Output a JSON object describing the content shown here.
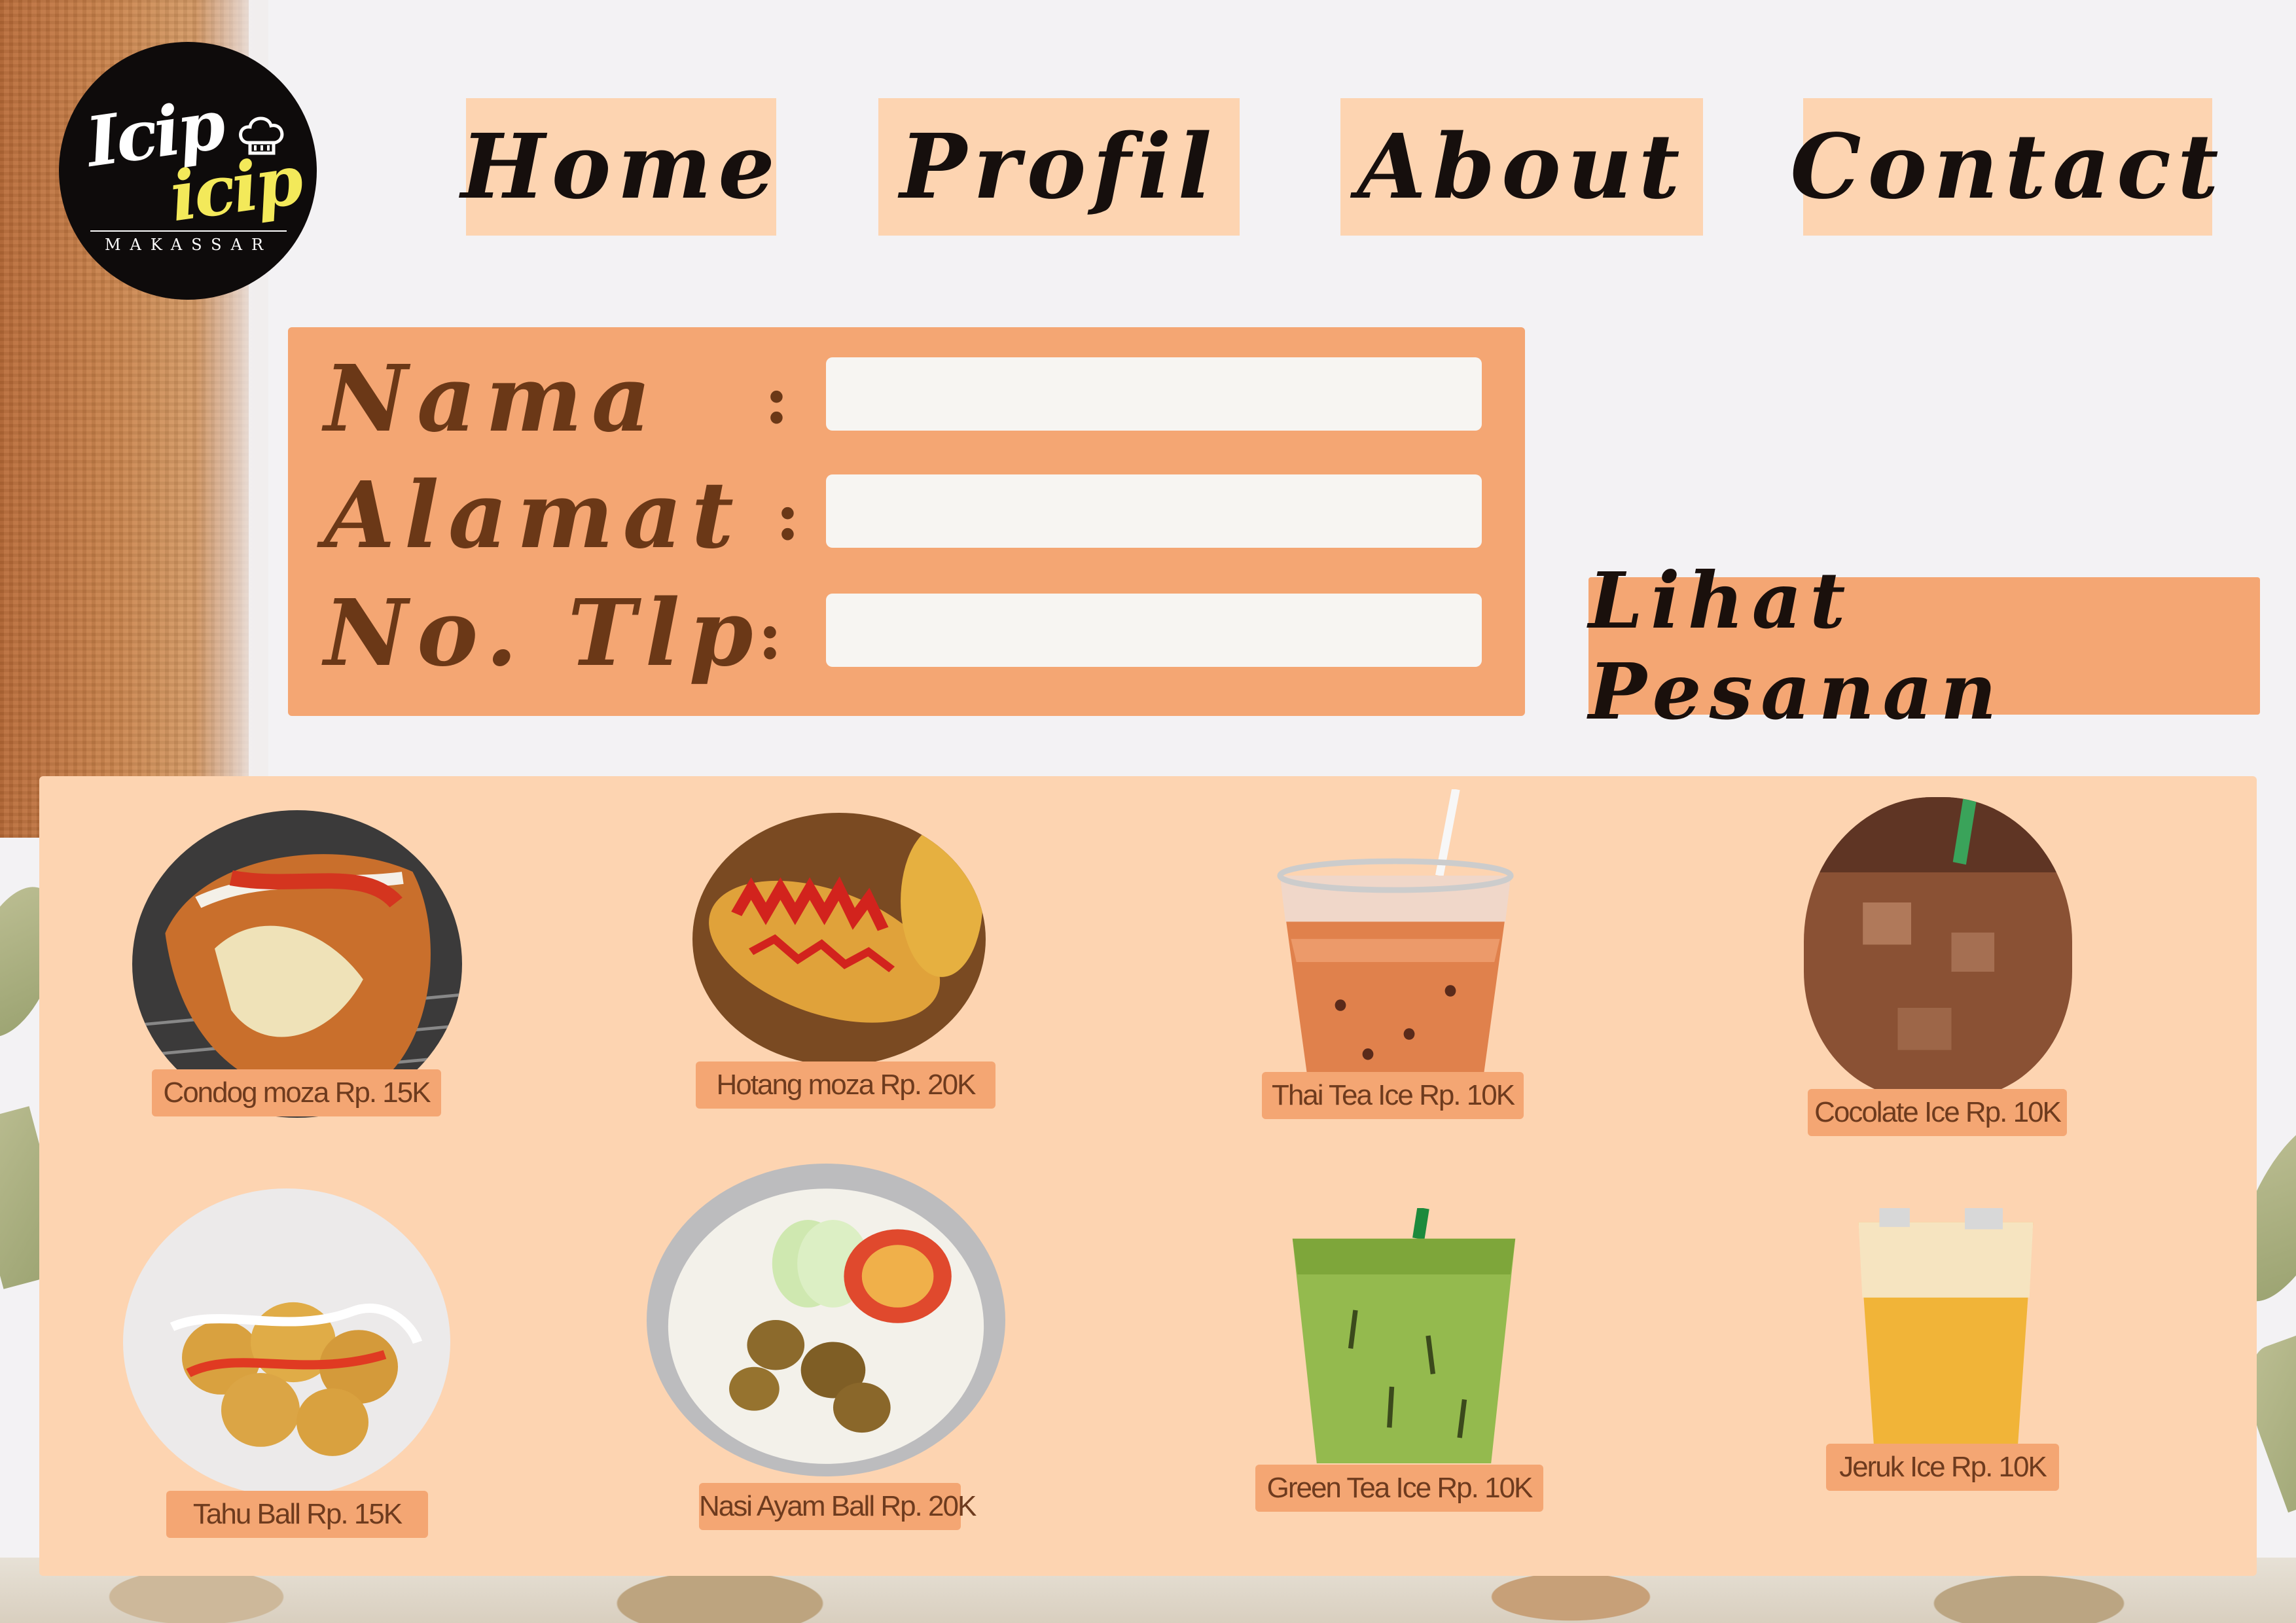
{
  "logo": {
    "line1": "Icip",
    "line2": "icip",
    "city": "MAKASSAR"
  },
  "nav": {
    "home": "Home",
    "profil": "Profil",
    "about": "About",
    "contact": "Contact"
  },
  "form": {
    "nama_label": "Nama",
    "alamat_label": "Alamat",
    "tlp_label": "No. Tlp",
    "colon": ":",
    "nama_value": "",
    "alamat_value": "",
    "tlp_value": ""
  },
  "order_button": "Lihat Pesanan",
  "menu": {
    "items": [
      {
        "label": "Condog moza Rp. 15K"
      },
      {
        "label": "Hotang moza Rp. 20K"
      },
      {
        "label": "Thai Tea Ice Rp. 10K"
      },
      {
        "label": "Cocolate Ice Rp. 10K"
      },
      {
        "label": "Tahu Ball Rp. 15K"
      },
      {
        "label": "Nasi Ayam Ball Rp. 20K"
      },
      {
        "label": "Green Tea Ice Rp. 10K"
      },
      {
        "label": "Jeruk Ice Rp. 10K"
      }
    ]
  },
  "colors": {
    "nav_bg": "#fdd4b1",
    "panel_accent": "#f4a673",
    "label_brown": "#6b3817",
    "menu_bg": "#fdd4b1"
  }
}
